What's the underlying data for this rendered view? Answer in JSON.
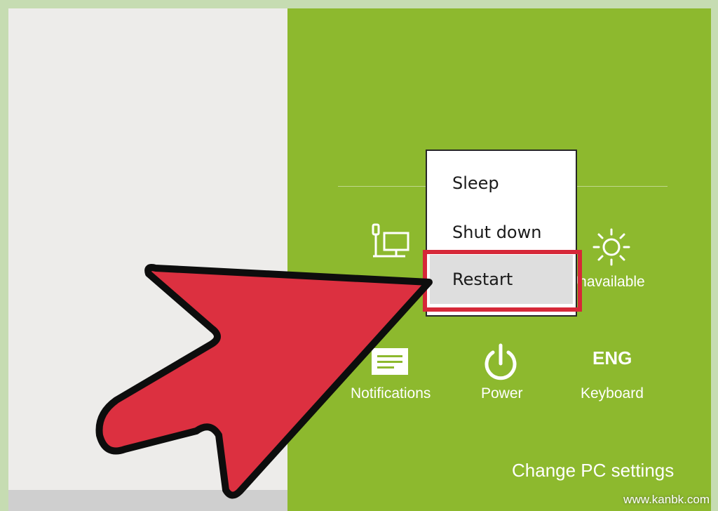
{
  "power_menu": {
    "sleep_label": "Sleep",
    "shutdown_label": "Shut down",
    "restart_label": "Restart"
  },
  "quick_settings": {
    "network_label": "",
    "brightness_label": "Unavailable",
    "notifications_label": "Notifications",
    "power_label": "Power",
    "keyboard_icon_text": "ENG",
    "keyboard_label": "Keyboard"
  },
  "footer": {
    "change_pc_settings_label": "Change PC settings"
  },
  "watermark": "www.kanbk.com",
  "colors": {
    "charm_background": "#8db92e",
    "desktop_background": "#edecea",
    "highlight_red": "#d62838",
    "arrow_red": "#dc3040"
  },
  "icons": {
    "network": "network-monitor-icon",
    "brightness": "brightness-sun-icon",
    "notifications": "notifications-icon",
    "power": "power-icon",
    "keyboard": "keyboard-language-icon"
  }
}
